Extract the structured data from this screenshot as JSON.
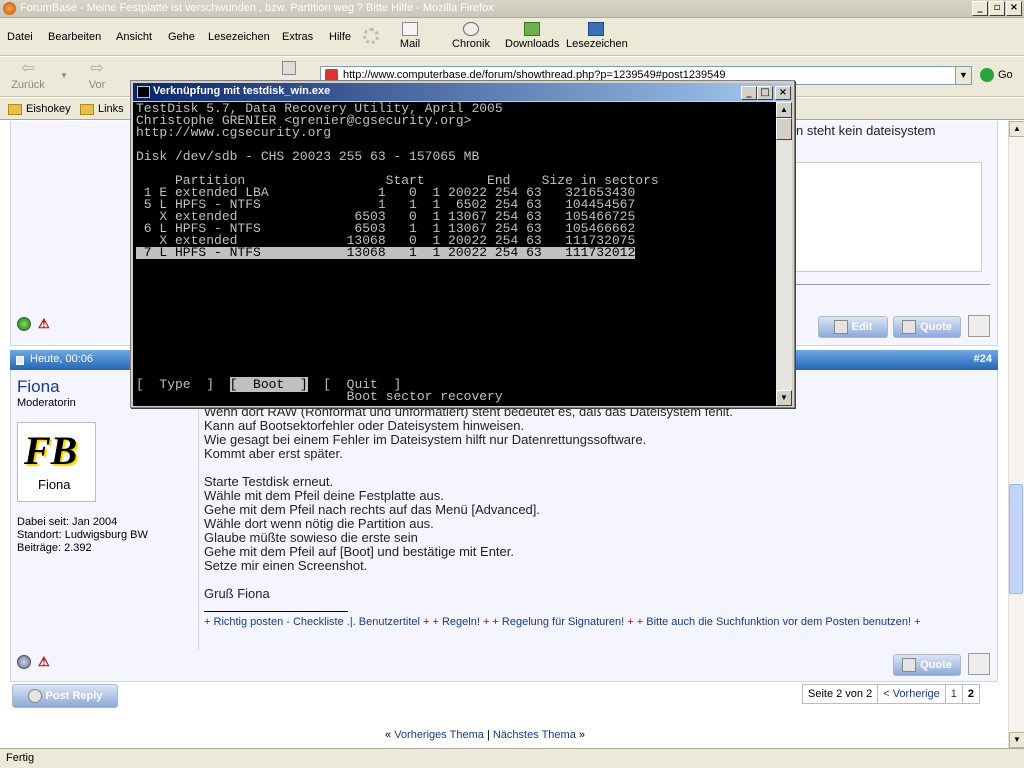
{
  "window": {
    "title": "ForumBase - Meine Festplatte ist verschwunden , bzw. Partition weg ? Bitte Hilfe - Mozilla Firefox"
  },
  "menu": [
    "Datei",
    "Bearbeiten",
    "Ansicht",
    "Gehe",
    "Lesezeichen",
    "Extras",
    "Hilfe"
  ],
  "toolbar": {
    "mail": "Mail",
    "history": "Chronik",
    "downloads": "Downloads",
    "bookmarks": "Lesezeichen"
  },
  "nav": {
    "back": "Zurück",
    "forward": "Vor",
    "url": "http://www.computerbase.de/forum/showthread.php?p=1239549#post1239549",
    "go": "Go"
  },
  "bookmarks": [
    "Eishokey",
    "Links"
  ],
  "console": {
    "title": "Verknüpfung mit testdisk_win.exe",
    "lines": [
      "TestDisk 5.7, Data Recovery Utility, April 2005",
      "Christophe GRENIER <grenier@cgsecurity.org>",
      "http://www.cgsecurity.org",
      "",
      "Disk /dev/sdb - CHS 20023 255 63 - 157065 MB",
      "",
      "     Partition                  Start        End    Size in sectors",
      " 1 E extended LBA              1   0  1 20022 254 63   321653430",
      " 5 L HPFS - NTFS               1   1  1  6502 254 63   104454567",
      "   X extended               6503   0  1 13067 254 63   105466725",
      " 6 L HPFS - NTFS            6503   1  1 13067 254 63   105466662",
      "   X extended              13068   0  1 20022 254 63   111732075"
    ],
    "selected_line": " 7 L HPFS - NTFS           13068   1  1 20022 254 63   111732012",
    "menu_before": "[  Type  ]  ",
    "menu_selected": "[  Boot  ]",
    "menu_after": "  [  Quit  ]",
    "hint": "                           Boot sector recovery"
  },
  "prev_post": {
    "text_fragment": "n steht kein dateisystem",
    "edit": "Edit",
    "quote": "Quote"
  },
  "post": {
    "date": "Heute, 00:06",
    "number": "#24",
    "username": "Fiona",
    "rank": "Moderatorin",
    "avatar_text_1": "FB",
    "avatar_text_2": "Fiona",
    "joined": "Dabei seit: Jan 2004",
    "location": "Standort: Ludwigsburg BW",
    "posts": "Beiträge: 2.392",
    "body": [
      "Wenn dort RAW (Rohformat und unformatiert) steht bedeutet es, daß das Dateisystem fehlt.",
      "Kann auf Bootsektorfehler oder Dateisystem hinweisen.",
      "Wie gesagt bei einem Fehler im Dateisystem hilft nur Datenrettungssoftware.",
      "Kommt aber erst später.",
      "",
      "Starte Testdisk erneut.",
      "Wähle mit dem Pfeil deine Festplatte aus.",
      "Gehe mit dem Pfeil nach rechts auf das Menü [Advanced].",
      "Wähle dort wenn nötig die Partition aus.",
      "Glaube müßte sowieso die erste sein",
      "Gehe mit dem Pfeil auf [Boot] und bestätige mit Enter.",
      "Setze mir einen Screenshot.",
      "",
      "Gruß Fiona"
    ],
    "signature": [
      {
        "plus": "+",
        "text": " Richtig posten - Checkliste .|. Benutzertitel "
      },
      {
        "plus": "+ +",
        "text": " Regeln! "
      },
      {
        "plus": "+ +",
        "text": " Regelung für Signaturen! "
      },
      {
        "plus": "+ +",
        "text": " Bitte auch die Suchfunktion vor dem Posten benutzen! "
      },
      {
        "plus": "+",
        "text": ""
      }
    ],
    "quote": "Quote"
  },
  "post_reply": "Post Reply",
  "pager": {
    "label": "Seite 2 von 2",
    "prev": "< Vorherige",
    "p1": "1",
    "p2": "2"
  },
  "thread_nav": {
    "left": "«",
    "prev": "Vorheriges Thema",
    "sep": "|",
    "next": "Nächstes Thema",
    "right": "»"
  },
  "status": "Fertig"
}
